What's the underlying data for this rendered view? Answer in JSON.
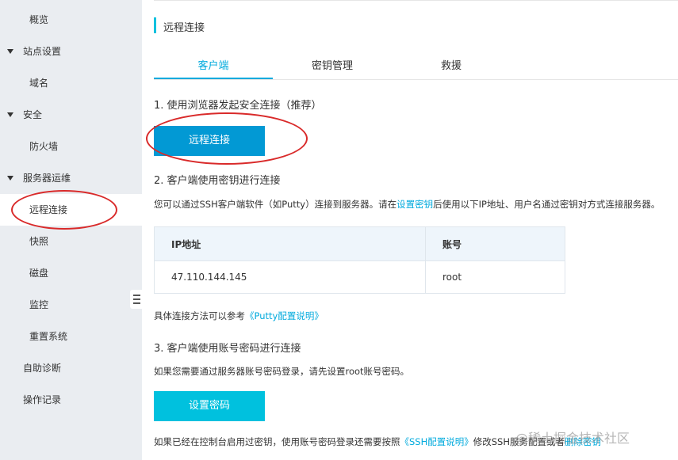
{
  "sidebar": {
    "items": [
      {
        "label": "概览",
        "level": 2
      },
      {
        "label": "站点设置",
        "level": 1
      },
      {
        "label": "域名",
        "level": 2
      },
      {
        "label": "安全",
        "level": 1
      },
      {
        "label": "防火墙",
        "level": 2
      },
      {
        "label": "服务器运维",
        "level": 1
      },
      {
        "label": "远程连接",
        "level": 2,
        "active": true
      },
      {
        "label": "快照",
        "level": 2
      },
      {
        "label": "磁盘",
        "level": 2
      },
      {
        "label": "监控",
        "level": 2
      },
      {
        "label": "重置系统",
        "level": 2
      },
      {
        "label": "自助诊断",
        "level": 1
      },
      {
        "label": "操作记录",
        "level": 1
      }
    ]
  },
  "page": {
    "title": "远程连接",
    "tabs": [
      {
        "label": "客户端",
        "active": true
      },
      {
        "label": "密钥管理"
      },
      {
        "label": "救援"
      }
    ]
  },
  "section1": {
    "heading": "1. 使用浏览器发起安全连接（推荐）",
    "button": "远程连接"
  },
  "section2": {
    "heading": "2. 客户端使用密钥进行连接",
    "desc_before": "您可以通过SSH客户端软件（如Putty）连接到服务器。请在",
    "desc_link": "设置密钥",
    "desc_after": "后使用以下IP地址、用户名通过密钥对方式连接服务器。",
    "table": {
      "headers": [
        "IP地址",
        "账号"
      ],
      "rows": [
        [
          "47.110.144.145",
          "root"
        ]
      ]
    },
    "note_before": "具体连接方法可以参考",
    "note_link": "《Putty配置说明》"
  },
  "section3": {
    "heading": "3. 客户端使用账号密码进行连接",
    "desc": "如果您需要通过服务器账号密码登录，请先设置root账号密码。",
    "button": "设置密码",
    "footer_before": "如果已经在控制台启用过密钥，使用账号密码登录还需要按照",
    "footer_link1": "《SSH配置说明》",
    "footer_mid": "修改SSH服务配置或者",
    "footer_link2": "删除密钥"
  },
  "watermark": "@稀土掘金技术社区",
  "colors": {
    "accent": "#00aadd",
    "primary_button": "#0299d4",
    "secondary_button": "#00c1de",
    "annotation": "#d92a2a",
    "sidebar_bg": "#eaedf1"
  }
}
